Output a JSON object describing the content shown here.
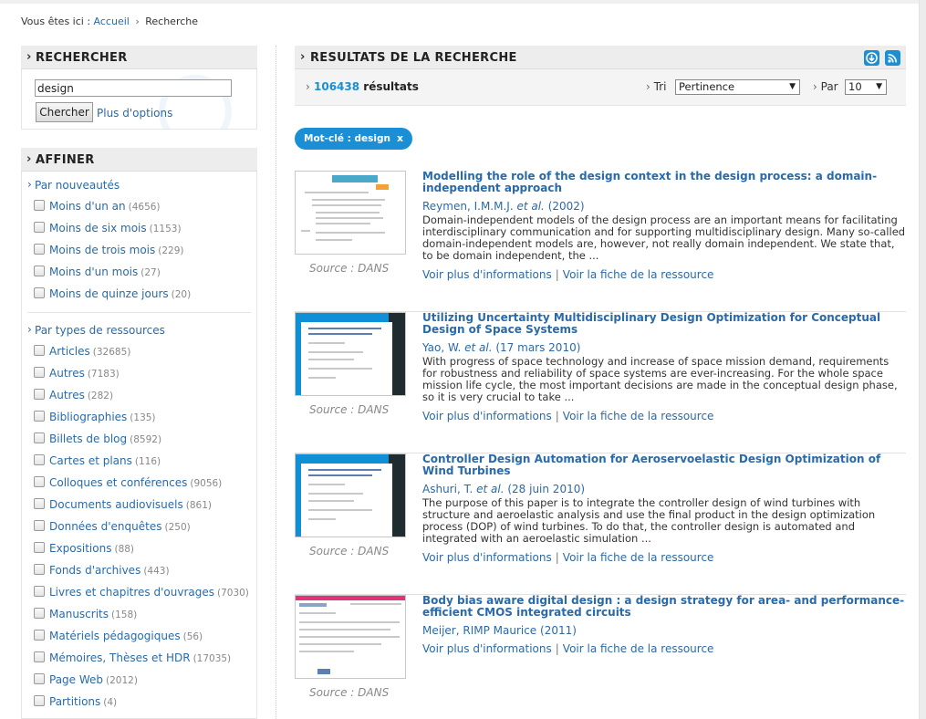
{
  "breadcrumb": {
    "prefix": "Vous êtes ici :",
    "home": "Accueil",
    "sep": "›",
    "current": "Recherche"
  },
  "search_panel": {
    "title": "RECHERCHER",
    "query": "design",
    "button": "Chercher",
    "more_options": "Plus d'options"
  },
  "refine_panel": {
    "title": "AFFINER",
    "groups": [
      {
        "title": "Par nouveautés",
        "items": [
          {
            "label": "Moins d'un an",
            "count": "(4656)"
          },
          {
            "label": "Moins de six mois",
            "count": "(1153)"
          },
          {
            "label": "Moins de trois mois",
            "count": "(229)"
          },
          {
            "label": "Moins d'un mois",
            "count": "(27)"
          },
          {
            "label": "Moins de quinze jours",
            "count": "(20)"
          }
        ]
      },
      {
        "title": "Par types de ressources",
        "items": [
          {
            "label": "Articles",
            "count": "(32685)"
          },
          {
            "label": "Autres",
            "count": "(7183)"
          },
          {
            "label": "Autres",
            "count": "(282)"
          },
          {
            "label": "Bibliographies",
            "count": "(135)"
          },
          {
            "label": "Billets de blog",
            "count": "(8592)"
          },
          {
            "label": "Cartes et plans",
            "count": "(116)"
          },
          {
            "label": "Colloques et conférences",
            "count": "(9056)"
          },
          {
            "label": "Documents audiovisuels",
            "count": "(861)"
          },
          {
            "label": "Données d'enquêtes",
            "count": "(250)"
          },
          {
            "label": "Expositions",
            "count": "(88)"
          },
          {
            "label": "Fonds d'archives",
            "count": "(443)"
          },
          {
            "label": "Livres et chapitres d'ouvrages",
            "count": "(7030)"
          },
          {
            "label": "Manuscrits",
            "count": "(158)"
          },
          {
            "label": "Matériels pédagogiques",
            "count": "(56)"
          },
          {
            "label": "Mémoires, Thèses et HDR",
            "count": "(17035)"
          },
          {
            "label": "Page Web",
            "count": "(2012)"
          },
          {
            "label": "Partitions",
            "count": "(4)"
          }
        ]
      }
    ]
  },
  "results_panel": {
    "title": "RESULTATS DE LA RECHERCHE",
    "count": "106438",
    "count_label": "résultats",
    "sort_label": "Tri",
    "sort_value": "Pertinence",
    "per_page_label": "Par",
    "per_page_value": "10",
    "active_filter": "Mot-clé : design",
    "remove_filter": "x",
    "source_label": "Source : DANS",
    "more_info": "Voir plus d'informations",
    "resource_sheet": "Voir la fiche de la ressource",
    "results": [
      {
        "title": "Modelling the role of the design context in the design process: a domain-independent approach",
        "authors": "Reymen, I.M.M.J. et al.",
        "date": "(2002)",
        "description": "Domain-independent models of the design process are an important means for facilitating interdisciplinary communication and for supporting multidisciplinary design. Many so-called domain-independent models are, however, not really domain independent. We state that, to be domain independent, the ...",
        "thumb": "paper"
      },
      {
        "title": "Utilizing Uncertainty Multidisciplinary Design Optimization for Conceptual Design of Space Systems",
        "authors": "Yao, W. et al.",
        "date": "(17 mars 2010)",
        "description": "With progress of space technology and increase of space mission demand, requirements for robustness and reliability of space systems are ever-increasing. For the whole space mission life cycle, the most important decisions are made in the conceptual design phase, so it is very crucial to take ...",
        "thumb": "blue"
      },
      {
        "title": "Controller Design Automation for Aeroservoelastic Design Optimization of Wind Turbines",
        "authors": "Ashuri, T. et al.",
        "date": "(28 juin 2010)",
        "description": "The purpose of this paper is to integrate the controller design of wind turbines with structure and aeroelastic analysis and use the final product in the design optimization process (DOP) of wind turbines. To do that, the controller design is automated and integrated with an aeroelastic simulation ...",
        "thumb": "blue"
      },
      {
        "title": "Body bias aware digital design : a design strategy for area- and performance-efficient CMOS integrated circuits",
        "authors": "Meijer, RIMP Maurice",
        "date": "(2011)",
        "description": "",
        "thumb": "pink"
      }
    ]
  },
  "colors": {
    "link": "#2a6aa8",
    "accent": "#1a8fd6",
    "panel_bg": "#ededed"
  },
  "icons": {
    "download": "download-icon",
    "rss": "rss-icon"
  }
}
